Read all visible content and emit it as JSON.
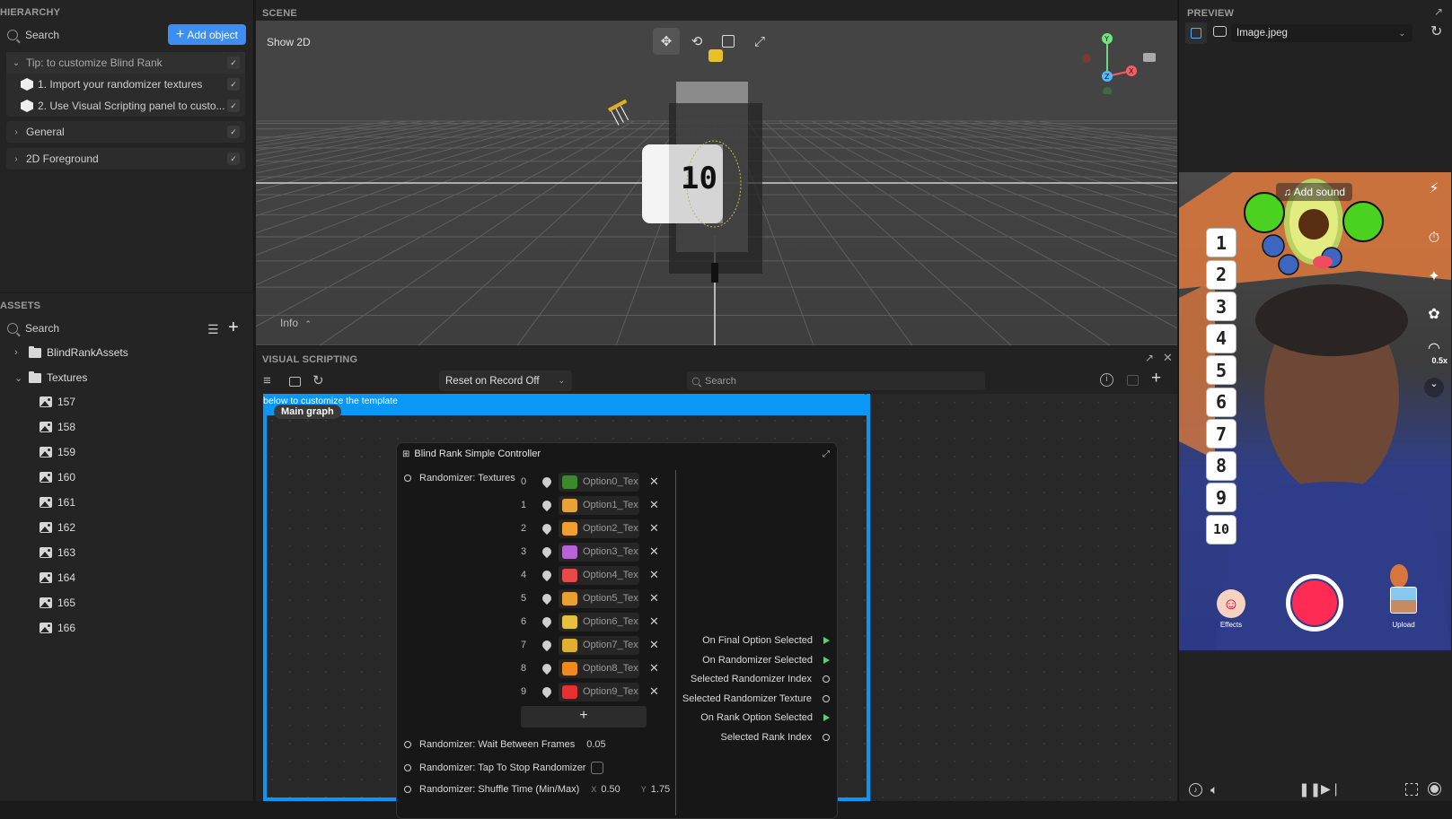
{
  "hierarchy": {
    "title": "HIERARCHY",
    "search_placeholder": "Search",
    "add_object_label": "Add object",
    "groups": [
      {
        "label": "Tip: to customize Blind Rank",
        "expanded": true,
        "checked": true,
        "children": [
          {
            "label": "1. Import your randomizer textures",
            "checked": true
          },
          {
            "label": "2. Use Visual Scripting panel to custo...",
            "checked": true
          }
        ]
      },
      {
        "label": "General",
        "expanded": false,
        "checked": true
      },
      {
        "label": "2D Foreground",
        "expanded": false,
        "checked": true
      }
    ]
  },
  "assets": {
    "title": "ASSETS",
    "search_placeholder": "Search",
    "folders": [
      {
        "label": "BlindRankAssets",
        "expanded": false
      },
      {
        "label": "Textures",
        "expanded": true
      }
    ],
    "textures": [
      "157",
      "158",
      "159",
      "160",
      "161",
      "162",
      "163",
      "164",
      "165",
      "166"
    ]
  },
  "scene": {
    "title": "SCENE",
    "show_2d_label": "Show 2D",
    "info_label": "Info",
    "tools": [
      "move-tool",
      "rotate-tool",
      "scale-tool",
      "pivot-tool"
    ],
    "active_tool": "move-tool",
    "gizmo_axes": {
      "x": "X",
      "y": "Y",
      "z": "Z"
    },
    "scene_object_label": "10"
  },
  "visual_scripting": {
    "title": "VISUAL SCRIPTING",
    "reset_select": "Reset on Record Off",
    "search_placeholder": "Search",
    "comment_text": "below to customize the template",
    "graph_tab": "Main graph",
    "node": {
      "title": "Blind Rank Simple Controller",
      "textures_label": "Randomizer: Textures",
      "textures": [
        {
          "index": "0",
          "name": "Option0_Tex",
          "color": "#3a8a2a"
        },
        {
          "index": "1",
          "name": "Option1_Tex",
          "color": "#e8a23a"
        },
        {
          "index": "2",
          "name": "Option2_Tex",
          "color": "#f0a030"
        },
        {
          "index": "3",
          "name": "Option3_Tex",
          "color": "#b862d8"
        },
        {
          "index": "4",
          "name": "Option4_Tex",
          "color": "#e84848"
        },
        {
          "index": "5",
          "name": "Option5_Tex",
          "color": "#e8a030"
        },
        {
          "index": "6",
          "name": "Option6_Tex",
          "color": "#e8c040"
        },
        {
          "index": "7",
          "name": "Option7_Tex",
          "color": "#e0b030"
        },
        {
          "index": "8",
          "name": "Option8_Tex",
          "color": "#f08a20"
        },
        {
          "index": "9",
          "name": "Option9_Tex",
          "color": "#e83030"
        }
      ],
      "add_label": "+",
      "wait_label": "Randomizer: Wait Between Frames",
      "wait_value": "0.05",
      "tap_label": "Randomizer: Tap To Stop Randomizer",
      "tap_checked": false,
      "shuffle_label": "Randomizer: Shuffle Time (Min/Max)",
      "shuffle_x_label": "X",
      "shuffle_x": "0.50",
      "shuffle_y_label": "Y",
      "shuffle_y": "1.75",
      "outputs": [
        {
          "label": "On Final Option Selected",
          "type": "exec"
        },
        {
          "label": "On Randomizer Selected",
          "type": "exec"
        },
        {
          "label": "Selected Randomizer Index",
          "type": "value"
        },
        {
          "label": "Selected Randomizer Texture",
          "type": "value"
        },
        {
          "label": "On Rank Option Selected",
          "type": "exec"
        },
        {
          "label": "Selected Rank Index",
          "type": "value"
        }
      ]
    }
  },
  "preview": {
    "title": "PREVIEW",
    "source_select": "Image.jpeg",
    "add_sound_label": "Add sound",
    "ranks": [
      "1",
      "2",
      "3",
      "4",
      "5",
      "6",
      "7",
      "8",
      "9",
      "10"
    ],
    "zoom_label": "0.5x",
    "effects_label": "Effects",
    "upload_label": "Upload",
    "record_color": "#fe2c55"
  },
  "colors": {
    "accent": "#3d8ef2",
    "comment": "#0b97f6",
    "exec_pin": "#4cd964"
  }
}
